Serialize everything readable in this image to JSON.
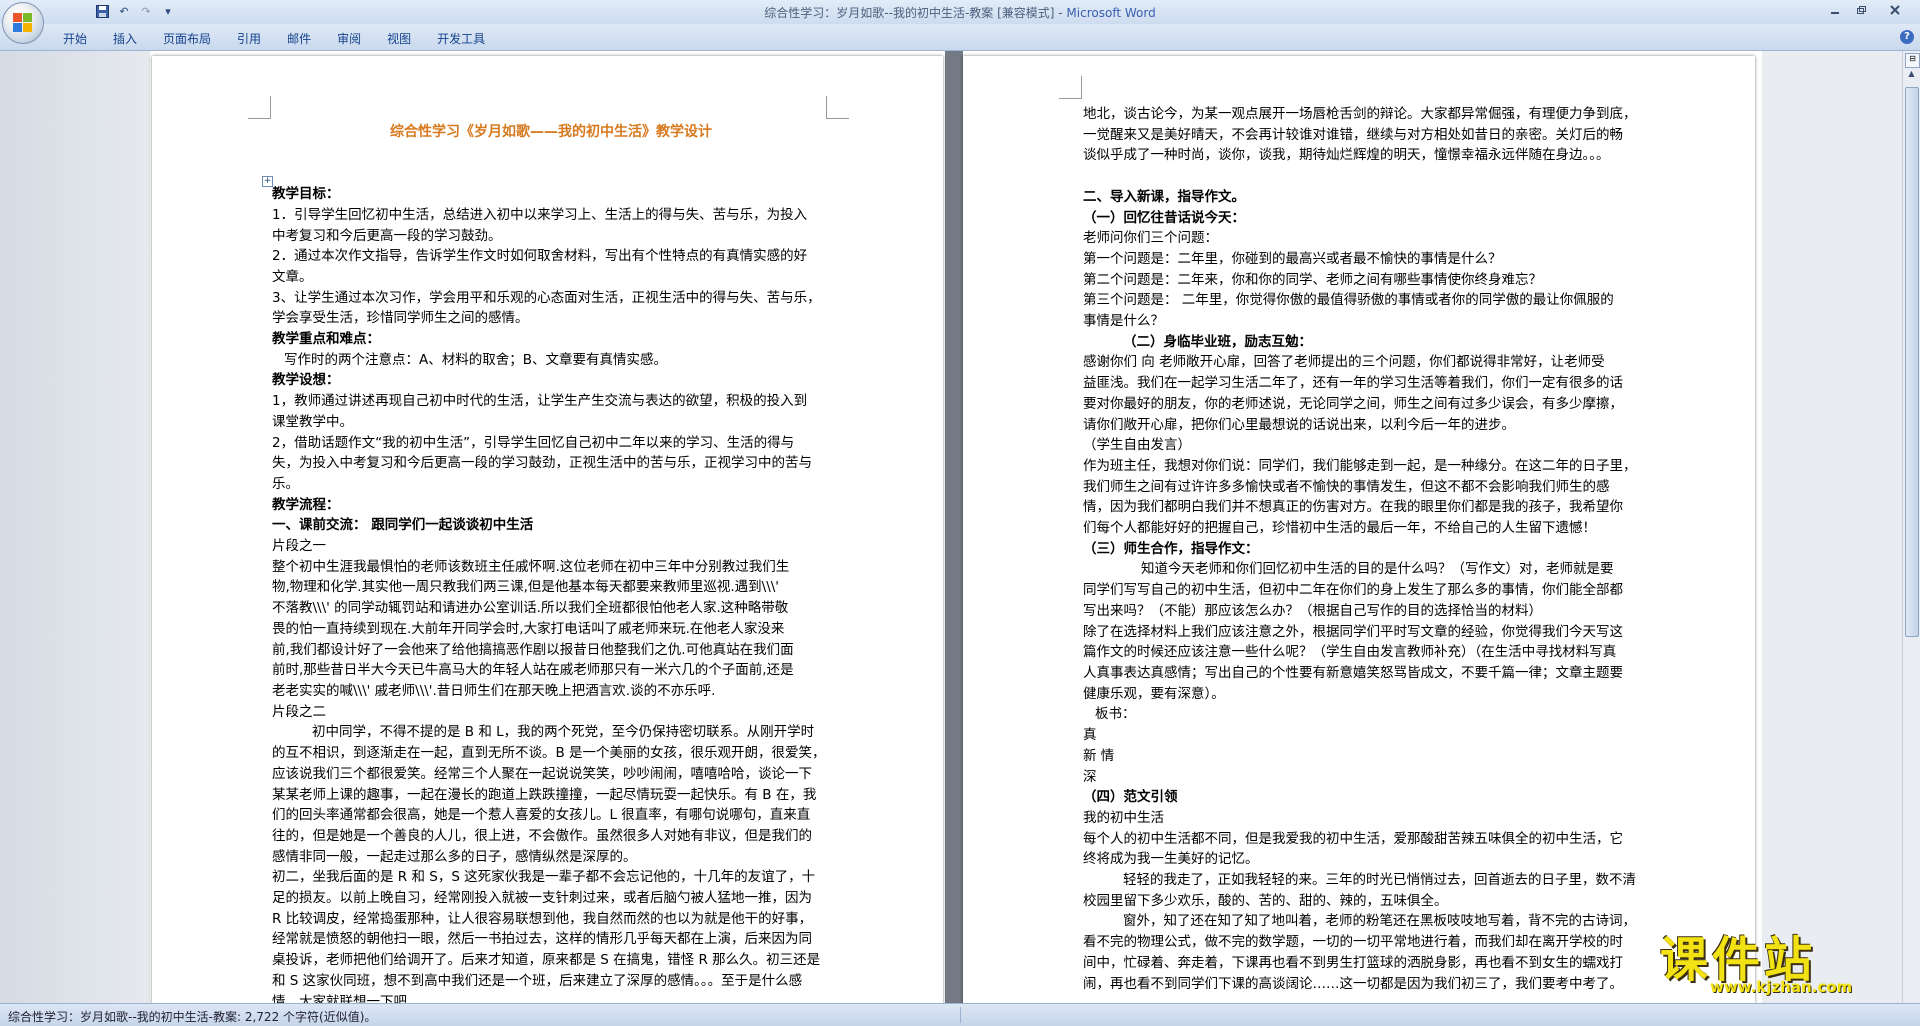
{
  "window": {
    "title": "综合性学习：岁月如歌--我的初中生活-教案 [兼容模式] - ",
    "app": "Microsoft Word"
  },
  "qat": {
    "save_icon": "save-icon",
    "undo_icon": "undo-icon",
    "redo_icon": "redo-icon",
    "customize": "▾"
  },
  "ribbon": {
    "tabs": [
      "开始",
      "插入",
      "页面布局",
      "引用",
      "邮件",
      "审阅",
      "视图",
      "开发工具"
    ]
  },
  "page1": {
    "title": "综合性学习《岁月如歌——我的初中生活》教学设计",
    "lines": [
      {
        "t": "",
        "s": "pm"
      },
      {
        "t": "",
        "s": "pm"
      },
      {
        "t": "教学目标：",
        "s": "b"
      },
      {
        "t": "1．引导学生回忆初中生活，总结进入初中以来学习上、生活上的得与失、苦与乐，为投入",
        "s": ""
      },
      {
        "t": "中考复习和今后更高一段的学习鼓劲。",
        "s": ""
      },
      {
        "t": "2．通过本次作文指导，告诉学生作文时如何取舍材料，写出有个性特点的有真情实感的好",
        "s": ""
      },
      {
        "t": "文章。",
        "s": ""
      },
      {
        "t": "3、让学生通过本次习作，学会用平和乐观的心态面对生活，正视生活中的得与失、苦与乐，",
        "s": ""
      },
      {
        "t": "学会享受生活，珍惜同学师生之间的感情。",
        "s": ""
      },
      {
        "t": "教学重点和难点：",
        "s": "b"
      },
      {
        "t": "写作时的两个注意点：A、材料的取舍；B、文章要有真情实感。",
        "s": "ind0"
      },
      {
        "t": "教学设想：",
        "s": "b"
      },
      {
        "t": "1，教师通过讲述再现自己初中时代的生活，让学生产生交流与表达的欲望，积极的投入到",
        "s": ""
      },
      {
        "t": "课堂教学中。",
        "s": ""
      },
      {
        "t": "2，借助话题作文“我的初中生活”，引导学生回忆自己初中二年以来的学习、生活的得与",
        "s": ""
      },
      {
        "t": "失，为投入中考复习和今后更高一段的学习鼓劲，正视生活中的苦与乐，正视学习中的苦与",
        "s": ""
      },
      {
        "t": "乐。",
        "s": ""
      },
      {
        "t": "教学流程：",
        "s": "b"
      },
      {
        "t": "一、课前交流：    跟同学们一起谈谈初中生活",
        "s": "bh"
      },
      {
        "t": "片段之一",
        "s": ""
      },
      {
        "t": "整个初中生涯我最惧怕的老师该数班主任戚怀啊.这位老师在初中三年中分别教过我们生",
        "s": ""
      },
      {
        "t": "物,物理和化学.其实他一周只教我们两三课,但是他基本每天都要来教师里巡视.遇到\\\\\\'",
        "s": ""
      },
      {
        "t": "不落教\\\\\\' 的同学动辄罚站和请进办公室训话.所以我们全班都很怕他老人家.这种略带敬",
        "s": ""
      },
      {
        "t": "畏的怕一直持续到现在.大前年开同学会时,大家打电话叫了戚老师来玩.在他老人家没来",
        "s": ""
      },
      {
        "t": "前,我们都设计好了一会他来了给他搞搞恶作剧以报昔日他整我们之仇.可他真站在我们面",
        "s": ""
      },
      {
        "t": "前时,那些昔日半大今天已牛高马大的年轻人站在戚老师那只有一米六几的个子面前,还是",
        "s": ""
      },
      {
        "t": "老老实实的喊\\\\\\' 戚老师\\\\\\'.昔日师生们在那天晚上把酒言欢.谈的不亦乐呼.",
        "s": ""
      },
      {
        "t": "片段之二",
        "s": ""
      },
      {
        "t": "初中同学，不得不提的是 B 和 L，我的两个死党，至今仍保持密切联系。从刚开学时",
        "s": "ind"
      },
      {
        "t": "的互不相识，到逐渐走在一起，直到无所不谈。B 是一个美丽的女孩，很乐观开朗，很爱笑，",
        "s": ""
      },
      {
        "t": "应该说我们三个都很爱笑。经常三个人聚在一起说说笑笑，吵吵闹闹，嘻嘻哈哈，谈论一下",
        "s": ""
      },
      {
        "t": "某某老师上课的趣事，一起在漫长的跑道上跌跌撞撞，一起尽情玩耍一起快乐。有 B 在，我",
        "s": ""
      },
      {
        "t": "们的回头率通常都会很高，她是一个惹人喜爱的女孩儿。L 很直率，有哪句说哪句，直来直",
        "s": ""
      },
      {
        "t": "往的，但是她是一个善良的人儿，很上进，不会傲作。虽然很多人对她有非议，但是我们的",
        "s": ""
      },
      {
        "t": "感情非同一般，一起走过那么多的日子，感情纵然是深厚的。",
        "s": ""
      },
      {
        "t": "初二，坐我后面的是 R 和 S，S 这死家伙我是一辈子都不会忘记他的，十几年的友谊了，十",
        "s": ""
      },
      {
        "t": "足的损友。以前上晚自习，经常刚投入就被一支针刺过来，或者后脑勺被人猛地一推，因为",
        "s": ""
      },
      {
        "t": "R 比较调皮，经常捣蛋那种，让人很容易联想到他，我自然而然的也以为就是他干的好事，",
        "s": ""
      },
      {
        "t": "经常就是愤怒的朝他扫一眼，然后一书拍过去，这样的情形几乎每天都在上演，后来因为同",
        "s": ""
      },
      {
        "t": "桌投诉，老师把他们给调开了。后来才知道，原来都是 S 在搞鬼，错怪 R 那么久。初三还是",
        "s": ""
      },
      {
        "t": "和 S 这家伙同班，想不到高中我们还是一个班，后来建立了深厚的感情。。。至于是什么感",
        "s": ""
      },
      {
        "t": "情，大家就联想一下吧。",
        "s": ""
      }
    ]
  },
  "page2": {
    "lines": [
      {
        "t": "地北，谈古论今，为某一观点展开一场唇枪舌剑的辩论。大家都异常倔强，有理便力争到底，",
        "s": ""
      },
      {
        "t": "一觉醒来又是美好晴天，不会再计较谁对谁错，继续与对方相处如昔日的亲密。关灯后的畅",
        "s": ""
      },
      {
        "t": "谈似乎成了一种时尚，谈你，谈我，期待灿烂辉煌的明天，憧憬幸福永远伴随在身边。。。",
        "s": ""
      },
      {
        "t": "",
        "s": "pm"
      },
      {
        "t": "二、导入新课，指导作文。",
        "s": "b"
      },
      {
        "t": "（一）回忆往昔话说今天：",
        "s": "b"
      },
      {
        "t": "老师问你们三个问题：",
        "s": ""
      },
      {
        "t": "第一个问题是：二年里，你碰到的最高兴或者最不愉快的事情是什么？",
        "s": ""
      },
      {
        "t": "第二个问题是：二年来，你和你的同学、老师之间有哪些事情使你终身难忘？",
        "s": ""
      },
      {
        "t": "第三个问题是：  二年里，你觉得你傲的最值得骄傲的事情或者你的同学傲的最让你佩服的",
        "s": ""
      },
      {
        "t": "事情是什么？",
        "s": ""
      },
      {
        "t": "（二）身临毕业班，励志互勉：",
        "s": "b ind"
      },
      {
        "t": "感谢你们   向   老师敞开心扉，回答了老师提出的三个问题，你们都说得非常好，让老师受",
        "s": ""
      },
      {
        "t": "益匪浅。我们在一起学习生活二年了，还有一年的学习生活等着我们，你们一定有很多的话",
        "s": ""
      },
      {
        "t": "要对你最好的朋友，你的老师述说，无论同学之间，师生之间有过多少误会，有多少摩擦，",
        "s": ""
      },
      {
        "t": "请你们敞开心扉，把你们心里最想说的话说出来，以利今后一年的进步。",
        "s": ""
      },
      {
        "t": "（学生自由发言）",
        "s": ""
      },
      {
        "t": "作为班主任，我想对你们说：同学们，我们能够走到一起，是一种缘分。在这二年的日子里，",
        "s": ""
      },
      {
        "t": "我们师生之间有过许许多多愉快或者不愉快的事情发生，但这不都不会影响我们师生的感",
        "s": ""
      },
      {
        "t": "情，因为我们都明白我们并不想真正的伤害对方。在我的眼里你们都是我的孩子，我希望你",
        "s": ""
      },
      {
        "t": "们每个人都能好好的把握自己，珍惜初中生活的最后一年，不给自己的人生留下遗憾！",
        "s": ""
      },
      {
        "t": "（三）师生合作，指导作文：",
        "s": "b"
      },
      {
        "t": "知道今天老师和你们回忆初中生活的目的是什么吗？（写作文）对，老师就是要",
        "s": "ind2"
      },
      {
        "t": "同学们写写自己的初中生活，但初中二年在你们的身上发生了那么多的事情，你们能全部都",
        "s": ""
      },
      {
        "t": "写出来吗？（不能）那应该怎么办？（根据自己写作的目的选择恰当的材料）",
        "s": ""
      },
      {
        "t": "除了在选择材料上我们应该注意之外，根据同学们平时写文章的经验，你觉得我们今天写这",
        "s": ""
      },
      {
        "t": "篇作文的时候还应该注意一些什么呢？（学生自由发言教师补充）（在生活中寻找材料写真",
        "s": ""
      },
      {
        "t": "人真事表达真感情；写出自己的个性要有新意嬉笑怒骂皆成文，不要千篇一律；文章主题要",
        "s": ""
      },
      {
        "t": "健康乐观，要有深意）。",
        "s": ""
      },
      {
        "t": "板书：",
        "s": "ind0"
      },
      {
        "t": "真",
        "s": ""
      },
      {
        "t": "新                          情",
        "s": ""
      },
      {
        "t": "深",
        "s": ""
      },
      {
        "t": "（四）范文引领",
        "s": "b"
      },
      {
        "t": "我的初中生活",
        "s": ""
      },
      {
        "t": "每个人的初中生活都不同，但是我爱我的初中生活，爱那酸甜苦辣五味俱全的初中生活，它",
        "s": ""
      },
      {
        "t": "终将成为我一生美好的记忆。",
        "s": ""
      },
      {
        "t": "轻轻的我走了，正如我轻轻的来。三年的时光已悄悄过去，回首逝去的日子里，数不清",
        "s": "ind"
      },
      {
        "t": "校园里留下多少欢乐，酸的、苦的、甜的、辣的，五味俱全。",
        "s": ""
      },
      {
        "t": "窗外，知了还在知了知了地叫着，老师的粉笔还在黑板吱吱地写着，背不完的古诗词，",
        "s": "ind"
      },
      {
        "t": "看不完的物理公式，做不完的数学题，一切的一切平常地进行着，而我们却在离开学校的时",
        "s": ""
      },
      {
        "t": "间中，忙碌着、奔走着，下课再也看不到男生打篮球的洒脱身影，再也看不到女生的蠕戏打",
        "s": ""
      },
      {
        "t": "闹，再也看不到同学们下课的高谈阔论……这一切都是因为我们初三了，我们要考中考了。",
        "s": ""
      }
    ]
  },
  "status": {
    "text": "综合性学习：岁月如歌--我的初中生活-教案: 2,722 个字符(近似值)。"
  },
  "watermark": {
    "title": "课件站",
    "url": "www.kjzhan.com"
  }
}
